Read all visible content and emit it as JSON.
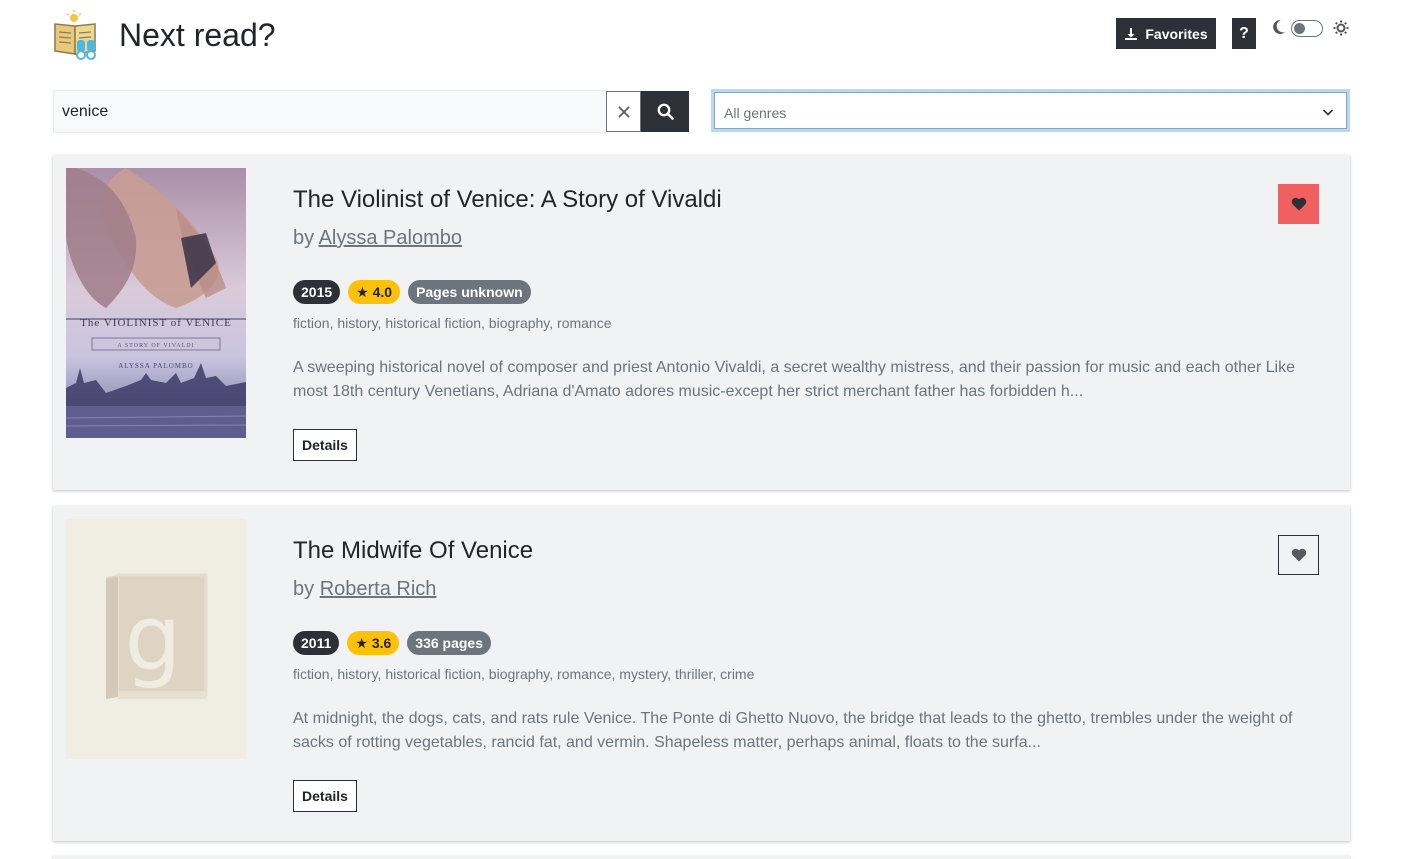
{
  "header": {
    "title": "Next read?",
    "logo_icon": "book-reading-icon",
    "favorites_label": "Favorites",
    "help_label": "?",
    "theme": {
      "dark_mode_on": false
    }
  },
  "search": {
    "value": "venice",
    "placeholder": "",
    "clear_icon": "close-icon",
    "submit_icon": "search-icon"
  },
  "genre_filter": {
    "selected": "All genres"
  },
  "colors": {
    "dark": "#2d3036",
    "rating_badge": "#ffc107",
    "favorite_active": "#f06060",
    "card_bg": "#f1f2f4"
  },
  "books": [
    {
      "title": "The Violinist of Venice: A Story of Vivaldi",
      "by": "by",
      "author": "Alyssa Palombo",
      "year": "2015",
      "rating": "★ 4.0",
      "pages": "Pages unknown",
      "genres": "fiction, history, historical fiction, biography, romance",
      "description": "A sweeping historical novel of composer and priest Antonio Vivaldi, a secret wealthy mistress, and their passion for music and each other Like most 18th century Venetians, Adriana d'Amato adores music-except her strict merchant father has forbidden h...",
      "details_label": "Details",
      "favorited": true,
      "cover": {
        "title_line": "The VIOLINIST of VENICE",
        "subtitle_line": "A STORY OF VIVALDI",
        "author_line": "ALYSSA PALOMBO"
      }
    },
    {
      "title": "The Midwife Of Venice",
      "by": "by",
      "author": "Roberta Rich",
      "year": "2011",
      "rating": "★ 3.6",
      "pages": "336 pages",
      "genres": "fiction, history, historical fiction, biography, romance, mystery, thriller, crime",
      "description": "At midnight, the dogs, cats, and rats rule Venice. The Ponte di Ghetto Nuovo, the bridge that leads to the ghetto, trembles under the weight of sacks of rotting vegetables, rancid fat, and vermin. Shapeless matter, perhaps animal, floats to the surfa...",
      "details_label": "Details",
      "favorited": false,
      "cover": {
        "placeholder_letter": "g"
      }
    }
  ]
}
